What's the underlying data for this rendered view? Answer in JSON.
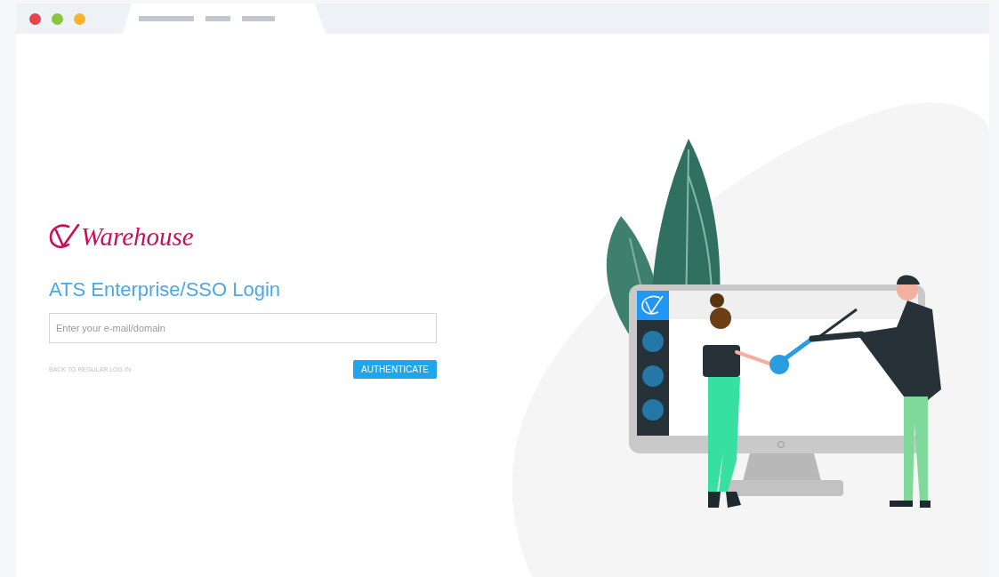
{
  "logo": {
    "text": "Warehouse"
  },
  "title": "ATS Enterprise/SSO Login",
  "email_field": {
    "placeholder": "Enter your e-mail/domain"
  },
  "back_link": "BACK TO REGULAR LOG IN",
  "authenticate_button": "AUTHENTICATE"
}
